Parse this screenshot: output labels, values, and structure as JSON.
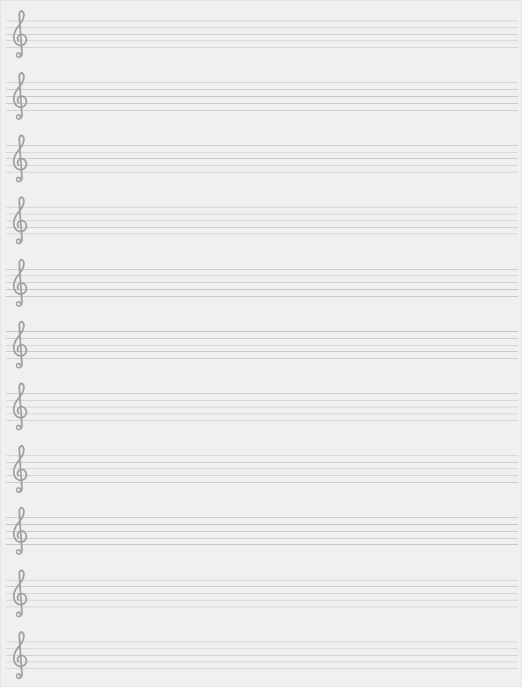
{
  "sheet": {
    "type": "blank-staff-paper",
    "staff_count": 11,
    "lines_per_staff": 5,
    "clef": "treble-clef-icon",
    "line_color": "#c4c4c4",
    "clef_color": "#9e9e9e",
    "background_color": "#f0f0f0"
  }
}
